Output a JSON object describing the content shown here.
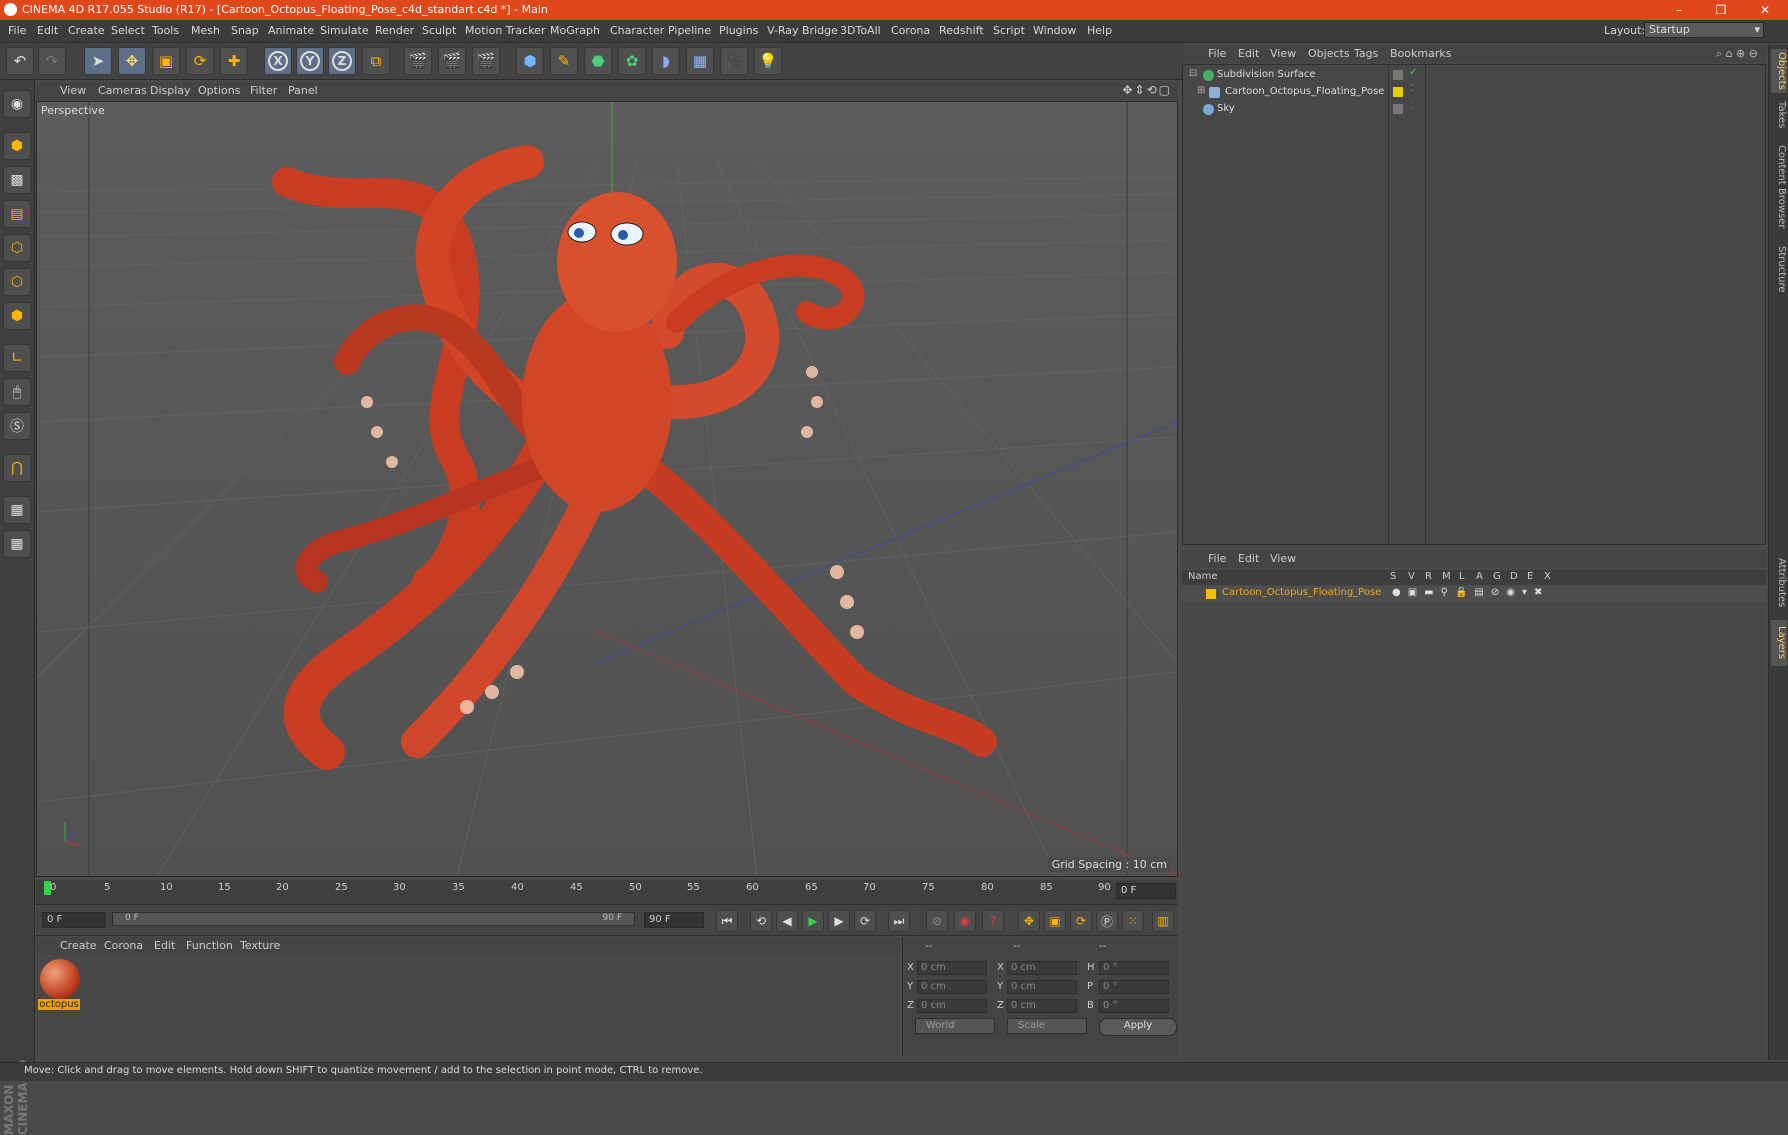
{
  "app": {
    "title": "CINEMA 4D R17.055 Studio (R17) - [Cartoon_Octopus_Floating_Pose_c4d_standart.c4d *] - Main",
    "window_controls": [
      "–",
      "❐",
      "✕"
    ]
  },
  "menu": {
    "items": [
      "File",
      "Edit",
      "Create",
      "Select",
      "Tools",
      "Mesh",
      "Snap",
      "Animate",
      "Simulate",
      "Render",
      "Sculpt",
      "Motion Tracker",
      "MoGraph",
      "Character",
      "Pipeline",
      "Plugins",
      "V-Ray Bridge",
      "3DToAll",
      "Corona",
      "Redshift",
      "Script",
      "Window",
      "Help"
    ],
    "layout_label": "Layout:",
    "layout_value": "Startup"
  },
  "viewport": {
    "menu": [
      "View",
      "Cameras",
      "Display",
      "Options",
      "Filter",
      "Panel"
    ],
    "label": "Perspective",
    "grid_spacing": "Grid Spacing : 10 cm",
    "axis_labels": {
      "x": "x",
      "y": "y"
    }
  },
  "timeline": {
    "ticks": [
      "0",
      "5",
      "10",
      "15",
      "20",
      "25",
      "30",
      "35",
      "40",
      "45",
      "50",
      "55",
      "60",
      "65",
      "70",
      "75",
      "80",
      "85",
      "90"
    ],
    "current_frame_box": "0 F"
  },
  "transport": {
    "start_field": "0 F",
    "range_start": "0 F",
    "range_end": "90 F",
    "end_field": "90 F"
  },
  "material_manager": {
    "menu": [
      "Create",
      "Corona",
      "Edit",
      "Function",
      "Texture"
    ],
    "materials": [
      {
        "name": "octopus"
      }
    ]
  },
  "coordinates": {
    "header": [
      "--",
      "--",
      "--"
    ],
    "rows": [
      {
        "a": "X",
        "av": "0 cm",
        "b": "X",
        "bv": "0 cm",
        "c": "H",
        "cv": "0 °"
      },
      {
        "a": "Y",
        "av": "0 cm",
        "b": "Y",
        "bv": "0 cm",
        "c": "P",
        "cv": "0 °"
      },
      {
        "a": "Z",
        "av": "0 cm",
        "b": "Z",
        "bv": "0 cm",
        "c": "B",
        "cv": "0 °"
      }
    ],
    "space": "World",
    "mode": "Scale",
    "apply": "Apply"
  },
  "object_manager": {
    "menu": [
      "File",
      "Edit",
      "View",
      "Objects",
      "Tags",
      "Bookmarks"
    ],
    "objects": [
      {
        "name": "Subdivision Surface",
        "icon_color": "#48b060"
      },
      {
        "name": "Cartoon_Octopus_Floating_Pose",
        "icon_color": "#8ab0d8"
      },
      {
        "name": "Sky",
        "icon_color": "#7aa8d8"
      }
    ]
  },
  "layer_manager": {
    "menu": [
      "File",
      "Edit",
      "View"
    ],
    "columns": [
      "Name",
      "S",
      "V",
      "R",
      "M",
      "L",
      "A",
      "G",
      "D",
      "E",
      "X"
    ],
    "layers": [
      {
        "name": "Cartoon_Octopus_Floating_Pose",
        "color": "#f0c000"
      }
    ]
  },
  "right_tabs": [
    "Objects",
    "Takes",
    "Content Browser",
    "Structure",
    "Attributes",
    "Layers"
  ],
  "status": {
    "text": "Move: Click and drag to move elements. Hold down SHIFT to quantize movement / add to the selection in point mode, CTRL to remove."
  },
  "brand": {
    "logo": "MAXON CINEMA 4D"
  },
  "colors": {
    "titlebar": "#e0481b",
    "accent_orange": "#f0a818"
  }
}
